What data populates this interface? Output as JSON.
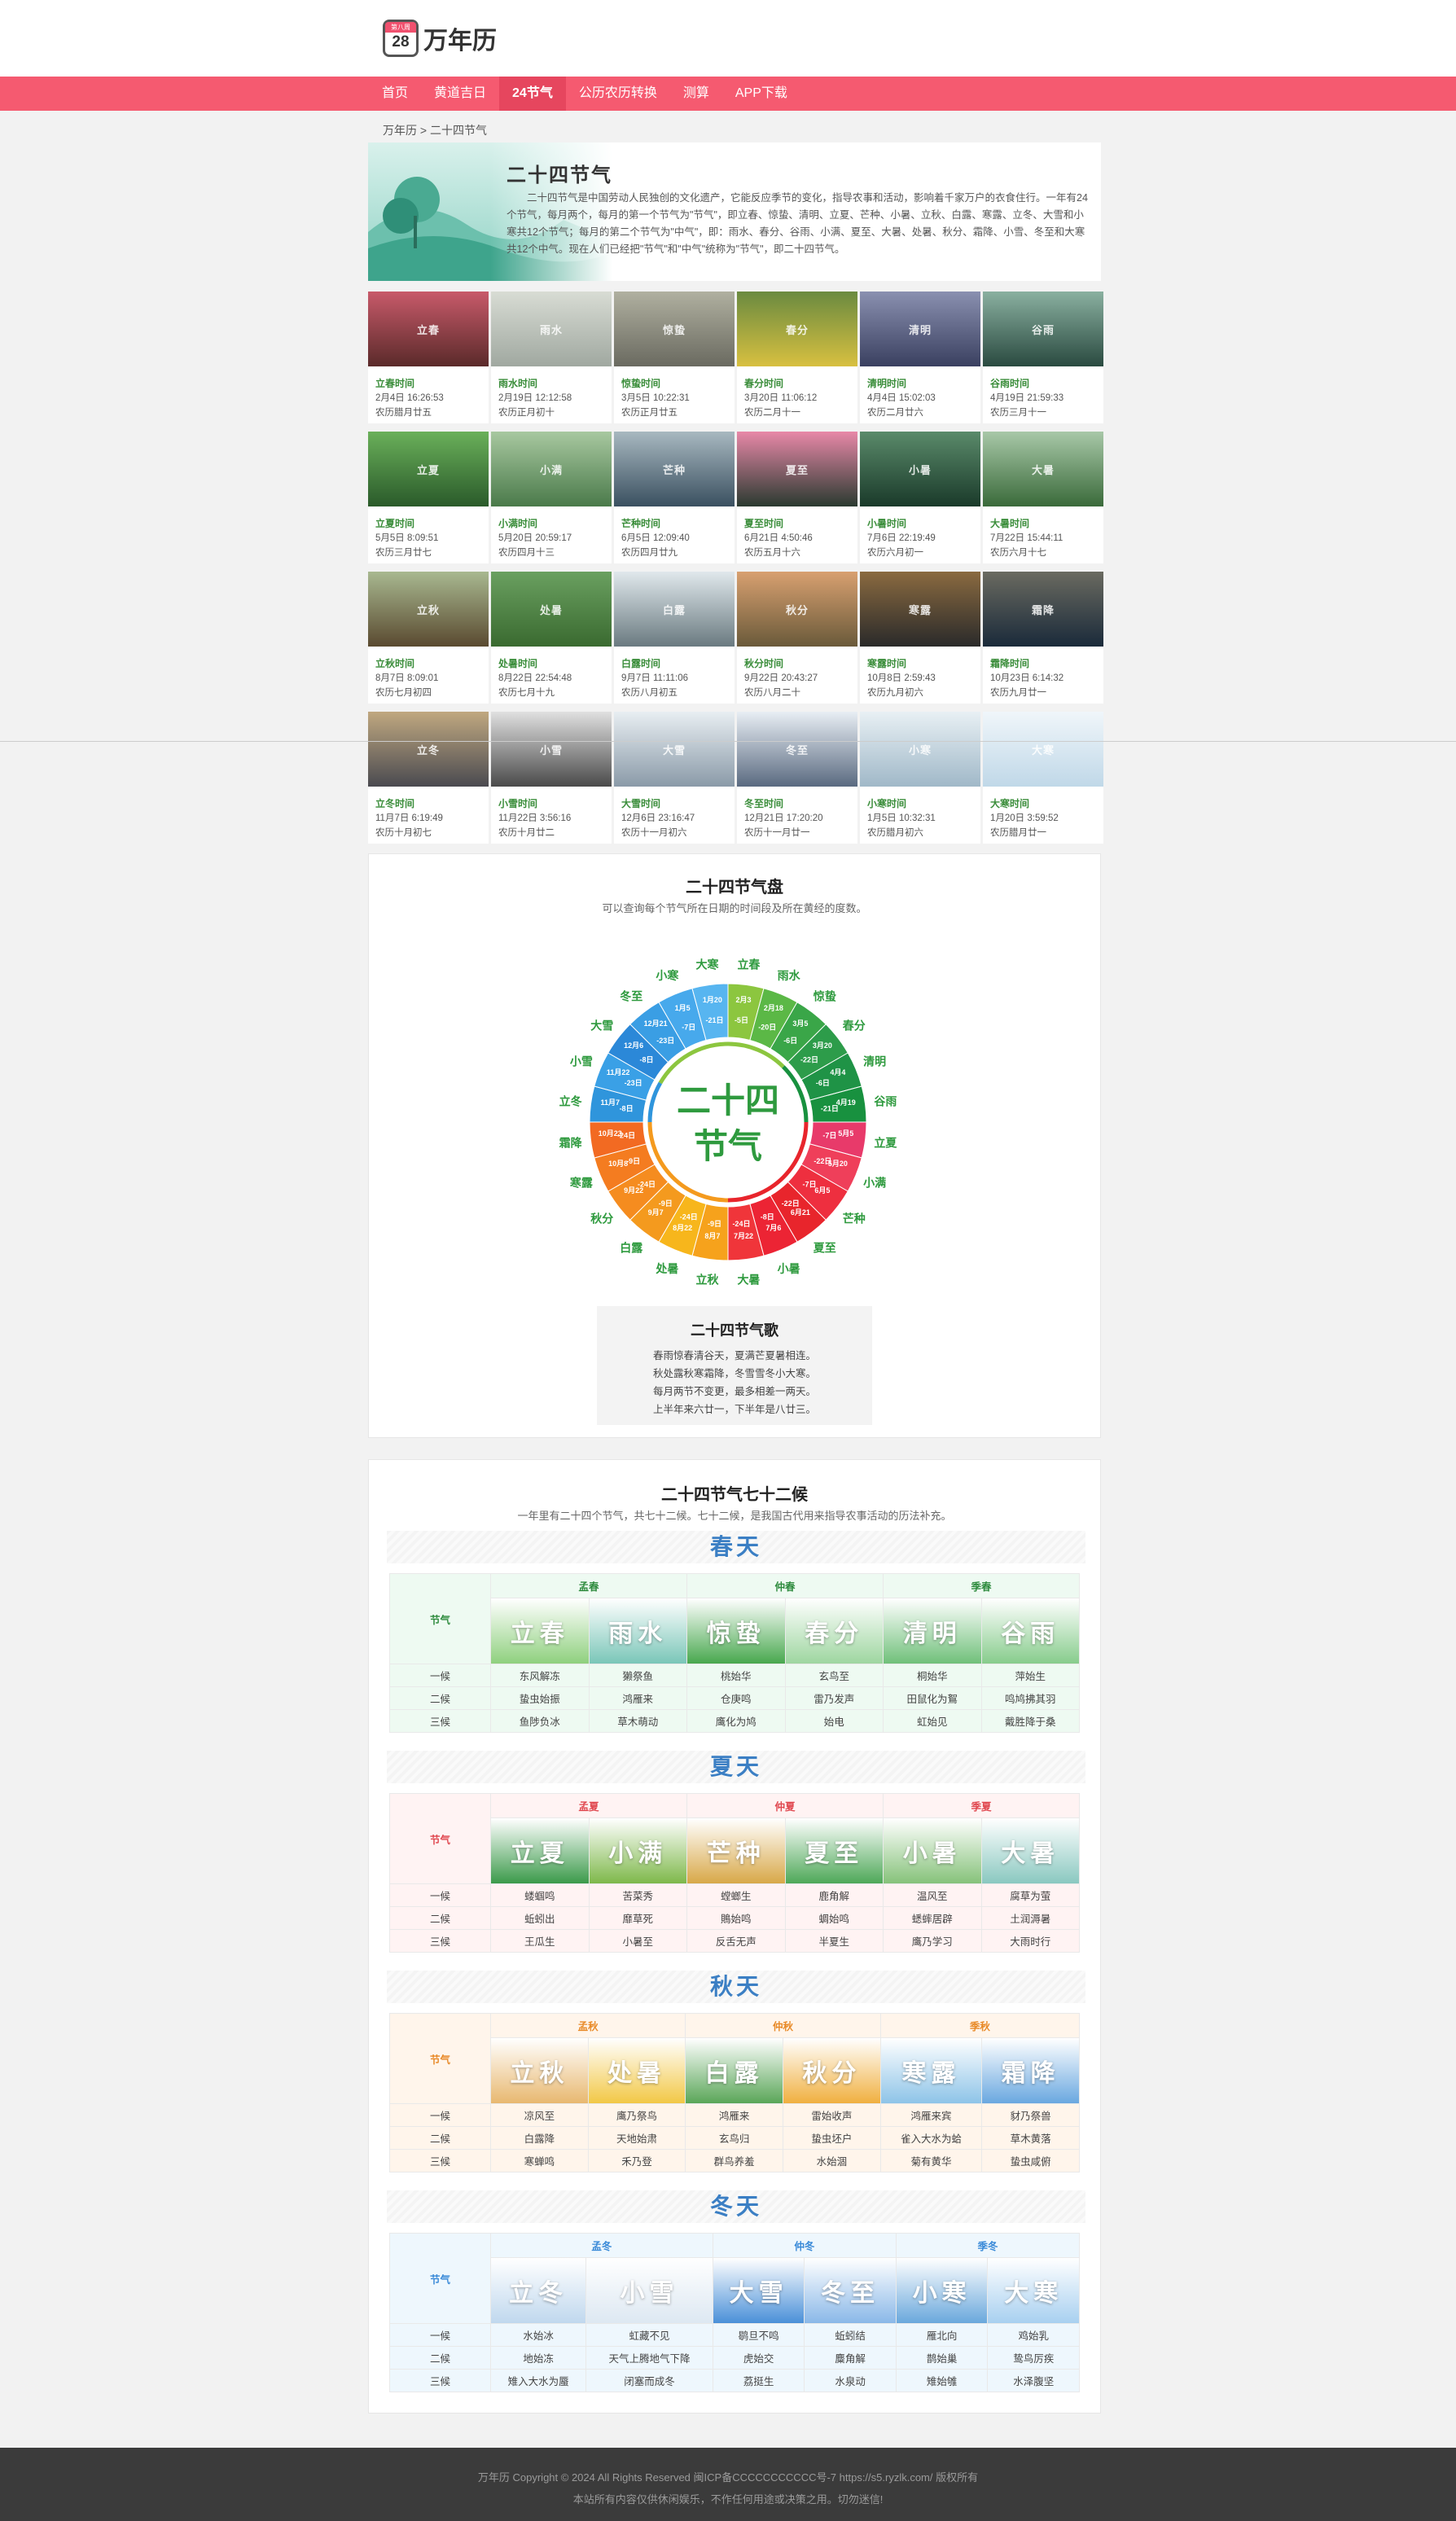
{
  "logo": {
    "badge": "第八周",
    "day": "28",
    "name": "万年历"
  },
  "nav": [
    "首页",
    "黄道吉日",
    "24节气",
    "公历农历转换",
    "测算",
    "APP下载"
  ],
  "nav_active": 2,
  "breadcrumb": "万年历 > 二十四节气",
  "intro": {
    "title": "二十四节气",
    "text": "二十四节气是中国劳动人民独创的文化遗产，它能反应季节的变化，指导农事和活动，影响着千家万户的衣食住行。一年有24个节气，每月两个，每月的第一个节气为\"节气\"，即立春、惊蛰、清明、立夏、芒种、小暑、立秋、白露、寒露、立冬、大雪和小寒共12个节气；每月的第二个节气为\"中气\"，即：雨水、春分、谷雨、小满、夏至、大暑、处暑、秋分、霜降、小雪、冬至和大寒共12个中气。现在人们已经把\"节气\"和\"中气\"统称为\"节气\"，即二十四节气。"
  },
  "terms": [
    {
      "name": "立春",
      "t1": "立春时间",
      "t2": "2月4日 16:26:53",
      "t3": "农历腊月廿五"
    },
    {
      "name": "雨水",
      "t1": "雨水时间",
      "t2": "2月19日 12:12:58",
      "t3": "农历正月初十"
    },
    {
      "name": "惊蛰",
      "t1": "惊蛰时间",
      "t2": "3月5日 10:22:31",
      "t3": "农历正月廿五"
    },
    {
      "name": "春分",
      "t1": "春分时间",
      "t2": "3月20日 11:06:12",
      "t3": "农历二月十一"
    },
    {
      "name": "清明",
      "t1": "清明时间",
      "t2": "4月4日 15:02:03",
      "t3": "农历二月廿六"
    },
    {
      "name": "谷雨",
      "t1": "谷雨时间",
      "t2": "4月19日 21:59:33",
      "t3": "农历三月十一"
    },
    {
      "name": "立夏",
      "t1": "立夏时间",
      "t2": "5月5日 8:09:51",
      "t3": "农历三月廿七"
    },
    {
      "name": "小满",
      "t1": "小满时间",
      "t2": "5月20日 20:59:17",
      "t3": "农历四月十三"
    },
    {
      "name": "芒种",
      "t1": "芒种时间",
      "t2": "6月5日 12:09:40",
      "t3": "农历四月廿九"
    },
    {
      "name": "夏至",
      "t1": "夏至时间",
      "t2": "6月21日 4:50:46",
      "t3": "农历五月十六"
    },
    {
      "name": "小暑",
      "t1": "小暑时间",
      "t2": "7月6日 22:19:49",
      "t3": "农历六月初一"
    },
    {
      "name": "大暑",
      "t1": "大暑时间",
      "t2": "7月22日 15:44:11",
      "t3": "农历六月十七"
    },
    {
      "name": "立秋",
      "t1": "立秋时间",
      "t2": "8月7日 8:09:01",
      "t3": "农历七月初四"
    },
    {
      "name": "处暑",
      "t1": "处暑时间",
      "t2": "8月22日 22:54:48",
      "t3": "农历七月十九"
    },
    {
      "name": "白露",
      "t1": "白露时间",
      "t2": "9月7日 11:11:06",
      "t3": "农历八月初五"
    },
    {
      "name": "秋分",
      "t1": "秋分时间",
      "t2": "9月22日 20:43:27",
      "t3": "农历八月二十"
    },
    {
      "name": "寒露",
      "t1": "寒露时间",
      "t2": "10月8日 2:59:43",
      "t3": "农历九月初六"
    },
    {
      "name": "霜降",
      "t1": "霜降时间",
      "t2": "10月23日 6:14:32",
      "t3": "农历九月廿一"
    },
    {
      "name": "立冬",
      "t1": "立冬时间",
      "t2": "11月7日 6:19:49",
      "t3": "农历十月初七"
    },
    {
      "name": "小雪",
      "t1": "小雪时间",
      "t2": "11月22日 3:56:16",
      "t3": "农历十月廿二"
    },
    {
      "name": "大雪",
      "t1": "大雪时间",
      "t2": "12月6日 23:16:47",
      "t3": "农历十一月初六"
    },
    {
      "name": "冬至",
      "t1": "冬至时间",
      "t2": "12月21日 17:20:20",
      "t3": "农历十一月廿一"
    },
    {
      "name": "小寒",
      "t1": "小寒时间",
      "t2": "1月5日 10:32:31",
      "t3": "农历腊月初六"
    },
    {
      "name": "大寒",
      "t1": "大寒时间",
      "t2": "1月20日 3:59:52",
      "t3": "农历腊月廿一"
    }
  ],
  "wheel": {
    "title": "二十四节气盘",
    "subtitle": "可以查询每个节气所在日期的时间段及所在黄经的度数。",
    "center": [
      "二十四",
      "节气"
    ],
    "order": [
      "立春",
      "雨水",
      "惊蛰",
      "春分",
      "清明",
      "谷雨",
      "立夏",
      "小满",
      "芒种",
      "夏至",
      "小暑",
      "大暑",
      "立秋",
      "处暑",
      "白露",
      "秋分",
      "寒露",
      "霜降",
      "立冬",
      "小雪",
      "大雪",
      "冬至",
      "小寒",
      "大寒"
    ],
    "dates": [
      [
        "2月3",
        "-5日"
      ],
      [
        "2月18",
        "-20日"
      ],
      [
        "3月5",
        "-6日"
      ],
      [
        "3月20",
        "-22日"
      ],
      [
        "4月4",
        "-6日"
      ],
      [
        "4月19",
        "-21日"
      ],
      [
        "5月5",
        "-7日"
      ],
      [
        "5月20",
        "-22日"
      ],
      [
        "6月5",
        "-7日"
      ],
      [
        "6月21",
        "-22日"
      ],
      [
        "7月6",
        "-8日"
      ],
      [
        "7月22",
        "-24日"
      ],
      [
        "8月7",
        "-9日"
      ],
      [
        "8月22",
        "-24日"
      ],
      [
        "9月7",
        "-9日"
      ],
      [
        "9月22",
        "-24日"
      ],
      [
        "10月8",
        "-9日"
      ],
      [
        "10月23",
        "-24日"
      ],
      [
        "11月7",
        "-8日"
      ],
      [
        "11月22",
        "-23日"
      ],
      [
        "12月6",
        "-8日"
      ],
      [
        "12月21",
        "-23日"
      ],
      [
        "1月5",
        "-7日"
      ],
      [
        "1月20",
        "-21日"
      ]
    ],
    "colors": [
      "#8cc63f",
      "#5bb846",
      "#3aa648",
      "#2d9c4a",
      "#1f9346",
      "#18913f",
      "#e83a6a",
      "#ef3f5a",
      "#ee2f3f",
      "#e8252c",
      "#ec2434",
      "#f0353a",
      "#f6a21c",
      "#f7b61c",
      "#f49a1e",
      "#f58c1f",
      "#f47c20",
      "#f26a22",
      "#2f95dc",
      "#3aa0e6",
      "#2b88d8",
      "#3a9ee4",
      "#47a9ec",
      "#57b5f0"
    ],
    "label_color": "#2e9a3e"
  },
  "song": {
    "title": "二十四节气歌",
    "lines": [
      "春雨惊春清谷天，夏满芒夏暑相连。",
      "秋处露秋寒霜降，冬雪雪冬小大寒。",
      "每月两节不变更，最多相差一两天。",
      "上半年来六廿一，下半年是八廿三。"
    ]
  },
  "hou": {
    "title": "二十四节气七十二候",
    "subtitle": "一年里有二十四个节气，共七十二候。七十二候，是我国古代用来指导农事活动的历法补充。",
    "row_label": "节气",
    "row_names": [
      "一候",
      "二候",
      "三候"
    ],
    "seasons": [
      {
        "name": "春天",
        "color": "#3b7fc4",
        "bg": "#eefaf2",
        "hdcolor": "#2e8b3e",
        "groups": [
          "孟春",
          "仲春",
          "季春"
        ],
        "terms": [
          "立春",
          "雨水",
          "惊蛰",
          "春分",
          "清明",
          "谷雨"
        ],
        "imgcolors": [
          "#8fd07e",
          "#7ac6b8",
          "#48a84e",
          "#9ed6a0",
          "#70c07a",
          "#87cc8c"
        ],
        "rows": [
          [
            "东风解冻",
            "獭祭鱼",
            "桃始华",
            "玄鸟至",
            "桐始华",
            "萍始生"
          ],
          [
            "蛰虫始振",
            "鸿雁来",
            "仓庚鸣",
            "雷乃发声",
            "田鼠化为鴽",
            "鸣鸠拂其羽"
          ],
          [
            "鱼陟负冰",
            "草木萌动",
            "鹰化为鸠",
            "始电",
            "虹始见",
            "戴胜降于桑"
          ]
        ]
      },
      {
        "name": "夏天",
        "color": "#3b7fc4",
        "bg": "#fff3f3",
        "hdcolor": "#e04850",
        "groups": [
          "孟夏",
          "仲夏",
          "季夏"
        ],
        "terms": [
          "立夏",
          "小满",
          "芒种",
          "夏至",
          "小暑",
          "大暑"
        ],
        "imgcolors": [
          "#3b9a4a",
          "#7eb84a",
          "#d8a848",
          "#4ea858",
          "#86c27a",
          "#8ac8c0"
        ],
        "rows": [
          [
            "蝼蝈鸣",
            "苦菜秀",
            "螳螂生",
            "鹿角解",
            "温风至",
            "腐草为萤"
          ],
          [
            "蚯蚓出",
            "靡草死",
            "鵙始鸣",
            "蜩始鸣",
            "蟋蟀居辟",
            "土润溽暑"
          ],
          [
            "王瓜生",
            "小暑至",
            "反舌无声",
            "半夏生",
            "鹰乃学习",
            "大雨时行"
          ]
        ]
      },
      {
        "name": "秋天",
        "color": "#3b7fc4",
        "bg": "#fff5eb",
        "hdcolor": "#e88a28",
        "groups": [
          "孟秋",
          "仲秋",
          "季秋"
        ],
        "terms": [
          "立秋",
          "处暑",
          "白露",
          "秋分",
          "寒露",
          "霜降"
        ],
        "imgcolors": [
          "#e8b870",
          "#f2c846",
          "#5aa658",
          "#f0b040",
          "#8ec4e8",
          "#6aa8e0"
        ],
        "rows": [
          [
            "凉风至",
            "鹰乃祭鸟",
            "鸿雁来",
            "雷始收声",
            "鸿雁来宾",
            "豺乃祭兽"
          ],
          [
            "白露降",
            "天地始肃",
            "玄鸟归",
            "蛰虫坯户",
            "雀入大水为蛤",
            "草木黄落"
          ],
          [
            "寒蝉鸣",
            "禾乃登",
            "群鸟养羞",
            "水始涸",
            "菊有黄华",
            "蛰虫咸俯"
          ]
        ]
      },
      {
        "name": "冬天",
        "color": "#3b7fc4",
        "bg": "#eef7fd",
        "hdcolor": "#3a8ad8",
        "groups": [
          "孟冬",
          "仲冬",
          "季冬"
        ],
        "terms": [
          "立冬",
          "小雪",
          "大雪",
          "冬至",
          "小寒",
          "大寒"
        ],
        "imgcolors": [
          "#c0d8ee",
          "#dde8f2",
          "#4a90d8",
          "#8ab8e8",
          "#6aa8dc",
          "#a8d0f0"
        ],
        "rows": [
          [
            "水始冰",
            "虹藏不见",
            "鹖旦不鸣",
            "蚯蚓结",
            "雁北向",
            "鸡始乳"
          ],
          [
            "地始冻",
            "天气上腾地气下降",
            "虎始交",
            "麋角解",
            "鹊始巢",
            "鸷鸟厉疾"
          ],
          [
            "雉入大水为蜃",
            "闭塞而成冬",
            "荔挺生",
            "水泉动",
            "雉始雊",
            "水泽腹坚"
          ]
        ]
      }
    ]
  },
  "footer": {
    "line1": "万年历   Copyright © 2024 All Rights Reserved    闽ICP备CCCCCCCCCCC号-7   https://s5.ryzlk.com/   版权所有",
    "line2": "本站所有内容仅供休闲娱乐，不作任何用途或决策之用。切勿迷信!"
  }
}
